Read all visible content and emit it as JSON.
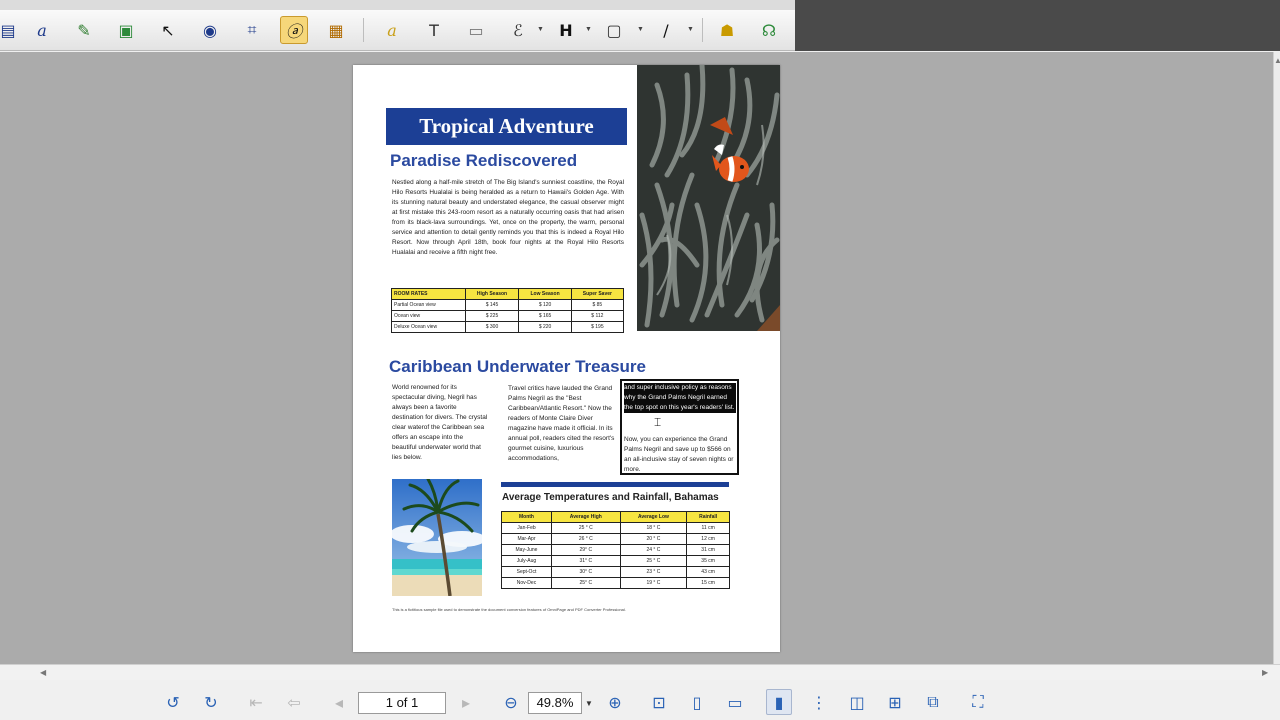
{
  "toolbar": {
    "tools": [
      {
        "name": "text-tool",
        "glyph": "a"
      },
      {
        "name": "edit-image-tool",
        "glyph": "✎"
      },
      {
        "name": "image-tool",
        "glyph": "▣"
      },
      {
        "name": "select-tool",
        "glyph": "↖"
      },
      {
        "name": "snapshot-tool",
        "glyph": "◉"
      },
      {
        "name": "crop-tool",
        "glyph": "⌗"
      },
      {
        "name": "touchup-text-tool",
        "glyph": "ⓐ"
      },
      {
        "name": "touchup-image-tool",
        "glyph": "▦"
      },
      {
        "name": "highlight-text-tool",
        "glyph": "a"
      },
      {
        "name": "textbox-tool",
        "glyph": "T"
      },
      {
        "name": "note-tool",
        "glyph": "▭"
      },
      {
        "name": "formula-tool",
        "glyph": "ℰ"
      },
      {
        "name": "heading-tool",
        "glyph": "H"
      },
      {
        "name": "shape-tool",
        "glyph": "▢"
      },
      {
        "name": "line-tool",
        "glyph": "/"
      },
      {
        "name": "users-tool",
        "glyph": "☗"
      },
      {
        "name": "share-tool",
        "glyph": "☊"
      }
    ]
  },
  "document": {
    "title": "Tropical Adventure",
    "section1": {
      "heading": "Paradise Rediscovered",
      "body": "Nestled along a half-mile stretch of The Big Island's sunniest coastline, the Royal Hilo Resorts Hualalai is being heralded as a return to Hawaii's Golden Age. With its stunning natural beauty and understated elegance, the casual observer might at first mistake this 243-room resort as a naturally occurring oasis that had arisen from its black-lava surroundings. Yet, once on the property, the warm, personal service and attention to detail gently reminds you that this is indeed a Royal Hilo Resort. Now through April 18th, book four nights at the Royal Hilo Resorts Hualalai and receive a fifth night free."
    },
    "rates_table": {
      "headers": [
        "ROOM RATES",
        "High Season",
        "Low Season",
        "Super Saver"
      ],
      "rows": [
        [
          "Partial Ocean view",
          "$ 145",
          "$ 120",
          "$ 85"
        ],
        [
          "Ocean view",
          "$ 225",
          "$ 165",
          "$ 112"
        ],
        [
          "Deluxe Ocean view",
          "$ 300",
          "$ 220",
          "$ 195"
        ]
      ]
    },
    "section2": {
      "heading": "Caribbean Underwater Treasure",
      "col1": "World renowned for its spectacular diving, Negril has always been a favorite destination for divers. The crystal clear waterof the Caribbean sea offers an escape into the beautiful underwater world that lies below.",
      "col2": "Travel critics have lauded the Grand Palms Negril as the \"Best Caribbean/Atlantic Resort.\" Now the readers of Monte Claire Diver magazine have made it official. In its annual poll, readers cited the resort's gourmet cuisine, luxurious accommodations,",
      "col3_selected": "and super inclusive policy as reasons why the Grand Palms Negril earned the top spot on this year's readers' list.",
      "col3_rest": "Now, you can experience the Grand Palms Negril and save up to $566 on an all-inclusive stay of seven nights or more."
    },
    "temps_heading": "Average Temperatures and Rainfall, Bahamas",
    "temps_table": {
      "headers": [
        "Month",
        "Average High",
        "Average Low",
        "Rainfall"
      ],
      "rows": [
        [
          "Jan-Feb",
          "25 ° C",
          "18 ° C",
          "11 cm"
        ],
        [
          "Mar-Apr",
          "26 ° C",
          "20 ° C",
          "12 cm"
        ],
        [
          "May-June",
          "29° C",
          "24 ° C",
          "31 cm"
        ],
        [
          "July-Aug",
          "31° C",
          "25 ° C",
          "35 cm"
        ],
        [
          "Sept-Oct",
          "30° C",
          "23 ° C",
          "43 cm"
        ],
        [
          "Nov-Dec",
          "25° C",
          "19 ° C",
          "15 cm"
        ]
      ]
    },
    "footnote": "This is a fictitious sample file used to demonstrate the document conversion features of OmniPage and PDF Converter Professional."
  },
  "navigation": {
    "page_display": "1 of 1",
    "zoom": "49.8%"
  },
  "colors": {
    "accent_blue": "#1c3f95",
    "heading_blue": "#2b4aa0",
    "table_header_yellow": "#f7e541",
    "active_tool": "#f6d77a"
  }
}
